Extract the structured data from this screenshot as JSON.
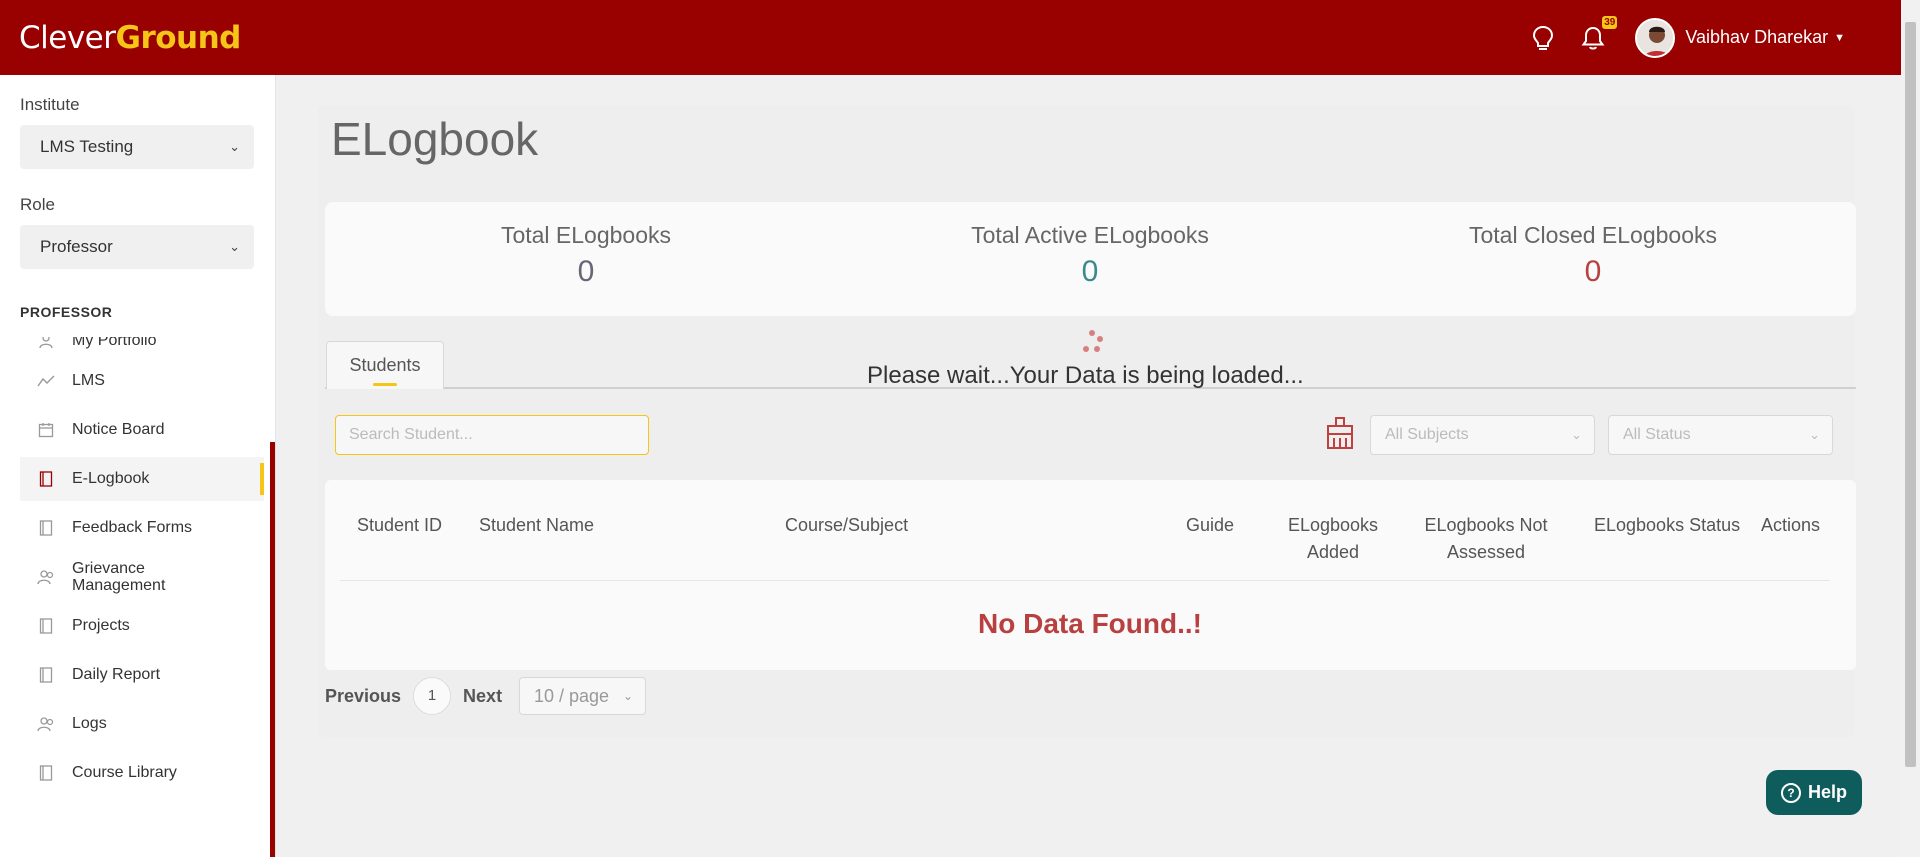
{
  "header": {
    "logo_part1": "Clever",
    "logo_part2": "Ground",
    "notification_count": "39",
    "user_name": "Vaibhav Dharekar",
    "brand_color": "#990000",
    "accent_color": "#f5c518"
  },
  "sidebar": {
    "institute_label": "Institute",
    "institute_value": "LMS Testing",
    "role_label": "Role",
    "role_value": "Professor",
    "section_title": "PROFESSOR",
    "items": [
      {
        "label": "My Portfolio",
        "icon": "user-icon"
      },
      {
        "label": "LMS",
        "icon": "chart-line-icon"
      },
      {
        "label": "Notice Board",
        "icon": "calendar-icon"
      },
      {
        "label": "E-Logbook",
        "icon": "book-icon",
        "active": true
      },
      {
        "label": "Feedback Forms",
        "icon": "book-icon"
      },
      {
        "label": "Grievance Management",
        "icon": "users-icon"
      },
      {
        "label": "Projects",
        "icon": "book-icon"
      },
      {
        "label": "Daily Report",
        "icon": "book-icon"
      },
      {
        "label": "Logs",
        "icon": "users-icon"
      },
      {
        "label": "Course Library",
        "icon": "book-icon"
      }
    ]
  },
  "main": {
    "title": "ELogbook",
    "stats": [
      {
        "label": "Total ELogbooks",
        "value": "0",
        "color": "#666677"
      },
      {
        "label": "Total Active ELogbooks",
        "value": "0",
        "color": "#3a8a8a"
      },
      {
        "label": "Total Closed ELogbooks",
        "value": "0",
        "color": "#b84040"
      }
    ],
    "tab_label": "Students",
    "loading_text": "Please wait...Your Data is being loaded...",
    "search_placeholder": "Search Student...",
    "subjects_filter": "All Subjects",
    "status_filter": "All Status",
    "table_headers": [
      "Student ID",
      "Student Name",
      "Course/Subject",
      "Guide",
      "ELogbooks Added",
      "ELogbooks Not Assessed",
      "ELogbooks Status",
      "Actions"
    ],
    "no_data": "No Data Found..!",
    "pagination": {
      "previous": "Previous",
      "current_page": "1",
      "next": "Next",
      "page_size": "10 / page"
    },
    "help_label": "Help"
  }
}
